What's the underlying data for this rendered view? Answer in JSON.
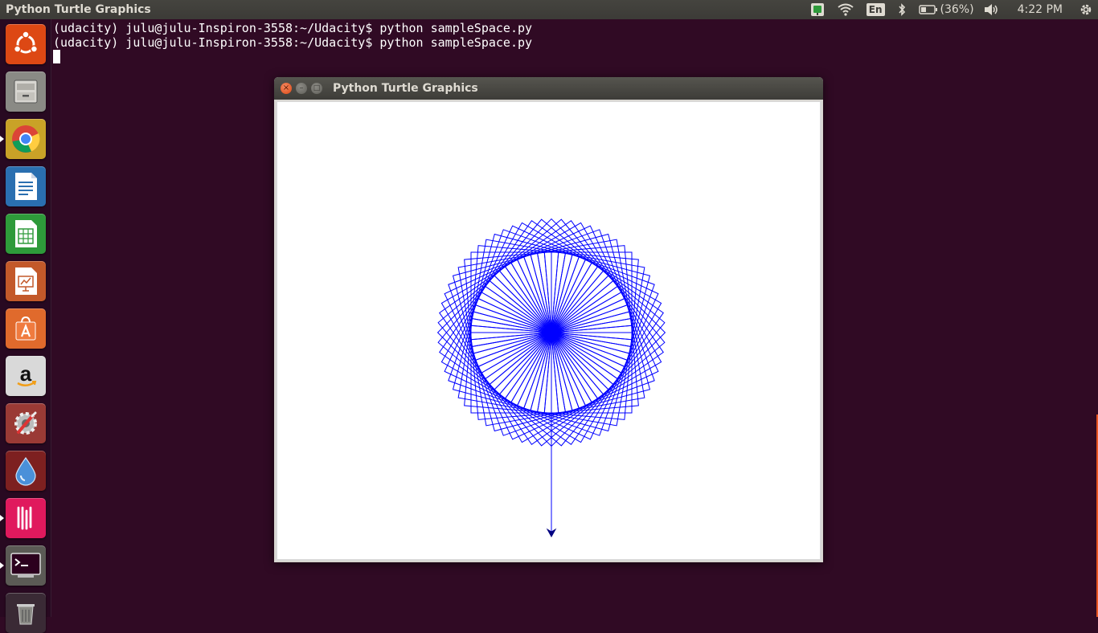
{
  "topbar": {
    "app_title": "Python Turtle Graphics",
    "battery_text": "(36%)",
    "keyboard_layout": "En",
    "time": "4:22 PM",
    "icons": [
      "indicator-app-icon",
      "wifi-icon",
      "keyboard-icon",
      "bluetooth-icon",
      "battery-icon",
      "volume-icon",
      "gear-icon"
    ]
  },
  "launcher": {
    "items": [
      {
        "name": "ubuntu-dash",
        "icon": "ubuntu-logo-icon",
        "color": "#dd4814"
      },
      {
        "name": "files",
        "icon": "file-cabinet-icon",
        "color": "#8a8a85"
      },
      {
        "name": "chrome",
        "icon": "chrome-icon",
        "color": "#c9a227",
        "running": true
      },
      {
        "name": "writer",
        "icon": "writer-document-icon",
        "color": "#2a6fb0"
      },
      {
        "name": "calc",
        "icon": "calc-spreadsheet-icon",
        "color": "#2e9a3a"
      },
      {
        "name": "impress",
        "icon": "impress-presentation-icon",
        "color": "#c3592a"
      },
      {
        "name": "software-center",
        "icon": "shopping-bag-icon",
        "color": "#e06a2c"
      },
      {
        "name": "amazon",
        "icon": "amazon-icon",
        "color": "#d9d9d9"
      },
      {
        "name": "system-settings",
        "icon": "settings-tools-icon",
        "color": "#9a3a35"
      },
      {
        "name": "drop-app",
        "icon": "water-drop-icon",
        "color": "#7d2020"
      },
      {
        "name": "gitkraken",
        "icon": "gitkraken-icon",
        "color": "#e0195d",
        "running": true
      },
      {
        "name": "terminal",
        "icon": "terminal-icon",
        "color": "#5b5a55",
        "running": true
      },
      {
        "name": "trash",
        "icon": "trash-icon",
        "color": "#3a2a35"
      }
    ]
  },
  "terminal": {
    "lines": [
      "(udacity) julu@julu-Inspiron-3558:~/Udacity$ python sampleSpace.py",
      "(udacity) julu@julu-Inspiron-3558:~/Udacity$ python sampleSpace.py"
    ]
  },
  "turtle_window": {
    "title": "Python Turtle Graphics",
    "close_glyph": "×",
    "min_glyph": "–",
    "max_glyph": "□",
    "pattern": {
      "stroke_color": "#0000ff",
      "loops": 72,
      "square_side": 100,
      "turn_between_loops_deg": 5,
      "stem_length": 250
    }
  }
}
